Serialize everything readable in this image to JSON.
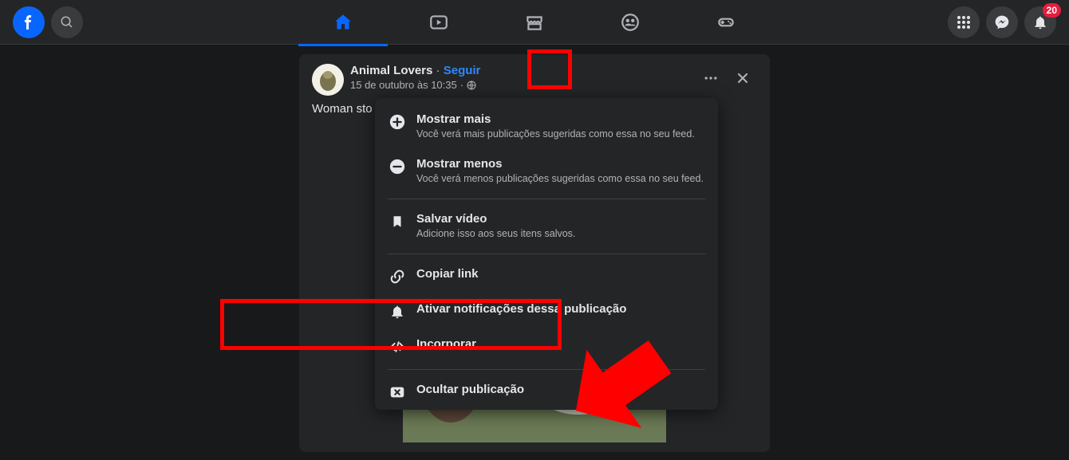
{
  "notification_count": "20",
  "post": {
    "author": "Animal Lovers",
    "follow": "Seguir",
    "timestamp": "15 de outubro às 10:35",
    "body_preview": "Woman sto"
  },
  "menu": {
    "show_more": {
      "label": "Mostrar mais",
      "desc": "Você verá mais publicações sugeridas como essa no seu feed."
    },
    "show_less": {
      "label": "Mostrar menos",
      "desc": "Você verá menos publicações sugeridas como essa no seu feed."
    },
    "save_video": {
      "label": "Salvar vídeo",
      "desc": "Adicione isso aos seus itens salvos."
    },
    "copy_link": {
      "label": "Copiar link"
    },
    "notifications_on": {
      "label": "Ativar notificações dessa publicação"
    },
    "embed": {
      "label": "Incorporar"
    },
    "hide_post": {
      "label": "Ocultar publicação"
    }
  }
}
